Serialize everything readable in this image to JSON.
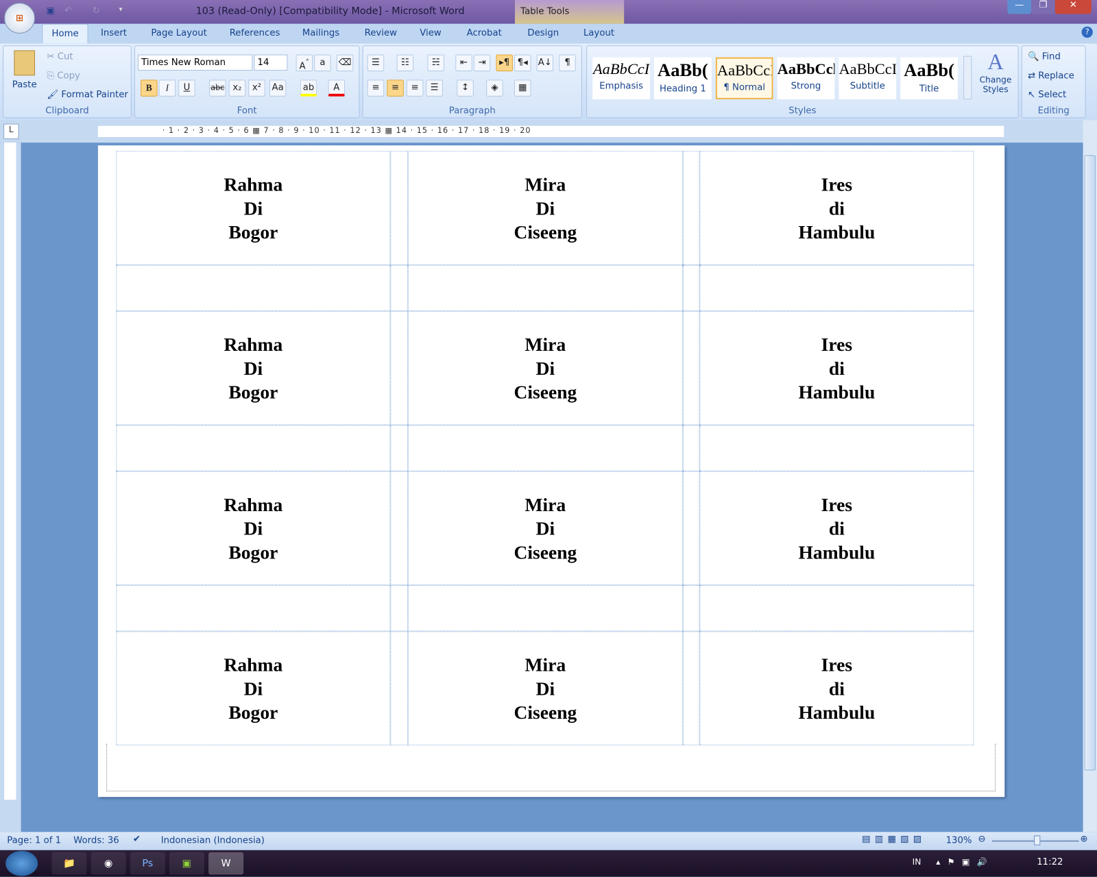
{
  "window": {
    "title": "103 (Read-Only) [Compatibility Mode] - Microsoft Word",
    "context_tab": "Table Tools"
  },
  "tabs": [
    "Home",
    "Insert",
    "Page Layout",
    "References",
    "Mailings",
    "Review",
    "View",
    "Acrobat",
    "Design",
    "Layout"
  ],
  "clipboard": {
    "paste": "Paste",
    "cut": "Cut",
    "copy": "Copy",
    "format_painter": "Format Painter",
    "label": "Clipboard"
  },
  "font": {
    "name": "Times New Roman",
    "size": "14",
    "label": "Font"
  },
  "paragraph": {
    "label": "Paragraph"
  },
  "styles": {
    "items": [
      {
        "preview": "AaBbCcI",
        "name": "Emphasis"
      },
      {
        "preview": "AaBb(",
        "name": "Heading 1"
      },
      {
        "preview": "AaBbCcI",
        "name": "¶ Normal"
      },
      {
        "preview": "AaBbCcl",
        "name": "Strong"
      },
      {
        "preview": "AaBbCcI",
        "name": "Subtitle"
      },
      {
        "preview": "AaBb(",
        "name": "Title"
      }
    ],
    "change": "Change Styles",
    "label": "Styles"
  },
  "editing": {
    "find": "Find",
    "replace": "Replace",
    "select": "Select",
    "label": "Editing"
  },
  "ruler": "· 1 · 2 · 3 · 4 · 5 · 6 ▦ 7 · 8 · 9 · 10 · 11 · 12 · 13 ▦ 14 · 15 · 16 · 17 · 18 · 19 · 20",
  "document": {
    "rows": [
      [
        [
          "Rahma",
          "Di",
          "Bogor"
        ],
        [
          "Mira",
          "Di",
          "Ciseeng"
        ],
        [
          "Ires",
          "di",
          "Hambulu"
        ]
      ],
      [
        [
          "Rahma",
          "Di",
          "Bogor"
        ],
        [
          "Mira",
          "Di",
          "Ciseeng"
        ],
        [
          "Ires",
          "di",
          "Hambulu"
        ]
      ],
      [
        [
          "Rahma",
          "Di",
          "Bogor"
        ],
        [
          "Mira",
          "Di",
          "Ciseeng"
        ],
        [
          "Ires",
          "di",
          "Hambulu"
        ]
      ],
      [
        [
          "Rahma",
          "Di",
          "Bogor"
        ],
        [
          "Mira",
          "Di",
          "Ciseeng"
        ],
        [
          "Ires",
          "di",
          "Hambulu"
        ]
      ]
    ]
  },
  "status": {
    "page": "Page: 1 of 1",
    "words": "Words: 36",
    "language": "Indonesian (Indonesia)",
    "zoom": "130%"
  },
  "taskbar": {
    "lang": "IN",
    "time": "11:22"
  }
}
